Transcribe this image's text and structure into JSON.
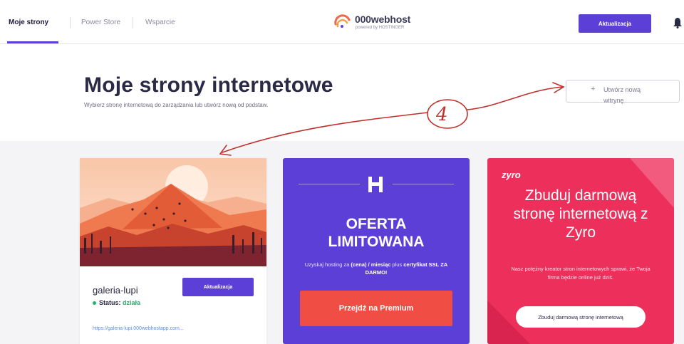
{
  "nav": {
    "tabs": [
      {
        "label": "Moje strony"
      },
      {
        "label": "Power Store"
      },
      {
        "label": "Wsparcie"
      }
    ],
    "brand_name": "000webhost",
    "brand_sub": "powered by HOSTINGER",
    "upgrade_label": "Aktualizacja"
  },
  "header": {
    "title": "Moje strony internetowe",
    "subtitle": "Wybierz stronę internetową do zarządzania lub utwórz nową od podstaw.",
    "create_plus": "+",
    "create_label": "Utwórz nową witrynę"
  },
  "annotation": {
    "number": "4"
  },
  "site_card": {
    "name": "galeria-lupi",
    "status_label": "Status:",
    "status_value": "działa",
    "upgrade_label": "Aktualizacja",
    "url": "https://galeria-lupi.000webhostapp.com..."
  },
  "promo_card": {
    "title_line1": "OFERTA",
    "title_line2": "LIMITOWANA",
    "text_part1": "Uzyskaj hosting za ",
    "text_bold1": "(cena) / miesiąc",
    "text_part2": " plus ",
    "text_bold2": "certyfikat SSL ZA DARMO!",
    "button_label": "Przejdź na Premium"
  },
  "zyro_card": {
    "logo": "zyro",
    "title": "Zbuduj darmową stronę internetową z Zyro",
    "text": "Nasz potężny kreator stron internetowych sprawi, że Twoja firma będzie online już dziś.",
    "button_label": "Zbuduj darmową stronę internetową"
  },
  "colors": {
    "accent": "#5b3fd6",
    "promo_button": "#f04e45",
    "zyro": "#ec2f5b",
    "status_ok": "#21b36b",
    "annotation": "#c0302d"
  }
}
